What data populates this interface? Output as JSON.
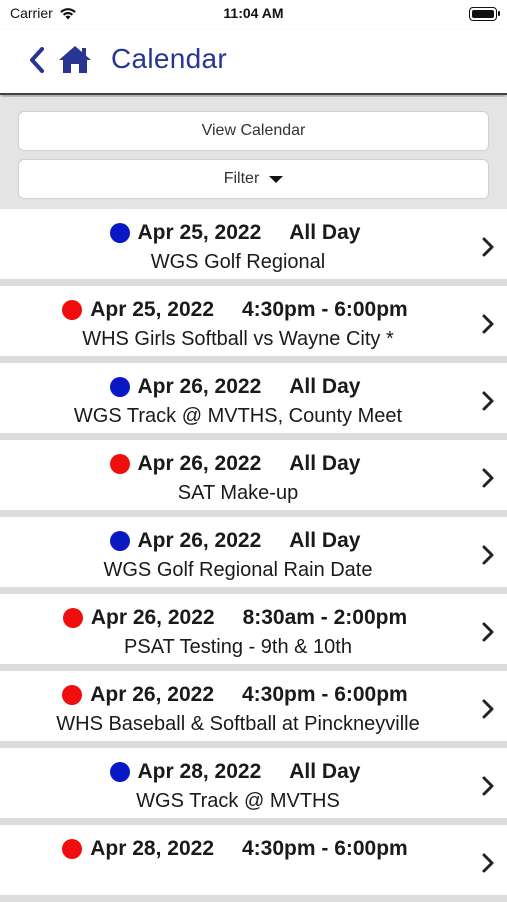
{
  "status": {
    "carrier": "Carrier",
    "time": "11:04 AM",
    "battery_level": 1.0
  },
  "nav": {
    "title": "Calendar",
    "back_icon": "chevron-left-icon",
    "home_icon": "home-icon",
    "accent_color": "#283593"
  },
  "controls": {
    "view_calendar": "View Calendar",
    "filter": "Filter"
  },
  "colors": {
    "blue": "#0a17c4",
    "red": "#f00d0d"
  },
  "events": [
    {
      "color": "blue",
      "date": "Apr 25, 2022",
      "time": "All Day",
      "title": "WGS Golf Regional"
    },
    {
      "color": "red",
      "date": "Apr 25, 2022",
      "time": "4:30pm - 6:00pm",
      "title": "WHS Girls Softball vs Wayne City *"
    },
    {
      "color": "blue",
      "date": "Apr 26, 2022",
      "time": "All Day",
      "title": "WGS Track @ MVTHS, County Meet"
    },
    {
      "color": "red",
      "date": "Apr 26, 2022",
      "time": "All Day",
      "title": "SAT Make-up"
    },
    {
      "color": "blue",
      "date": "Apr 26, 2022",
      "time": "All Day",
      "title": "WGS Golf Regional Rain Date"
    },
    {
      "color": "red",
      "date": "Apr 26, 2022",
      "time": "8:30am - 2:00pm",
      "title": "PSAT Testing - 9th & 10th"
    },
    {
      "color": "red",
      "date": "Apr 26, 2022",
      "time": "4:30pm - 6:00pm",
      "title": "WHS Baseball & Softball at Pinckneyville"
    },
    {
      "color": "blue",
      "date": "Apr 28, 2022",
      "time": "All Day",
      "title": "WGS Track @ MVTHS"
    },
    {
      "color": "red",
      "date": "Apr 28, 2022",
      "time": "4:30pm - 6:00pm",
      "title": ""
    }
  ]
}
